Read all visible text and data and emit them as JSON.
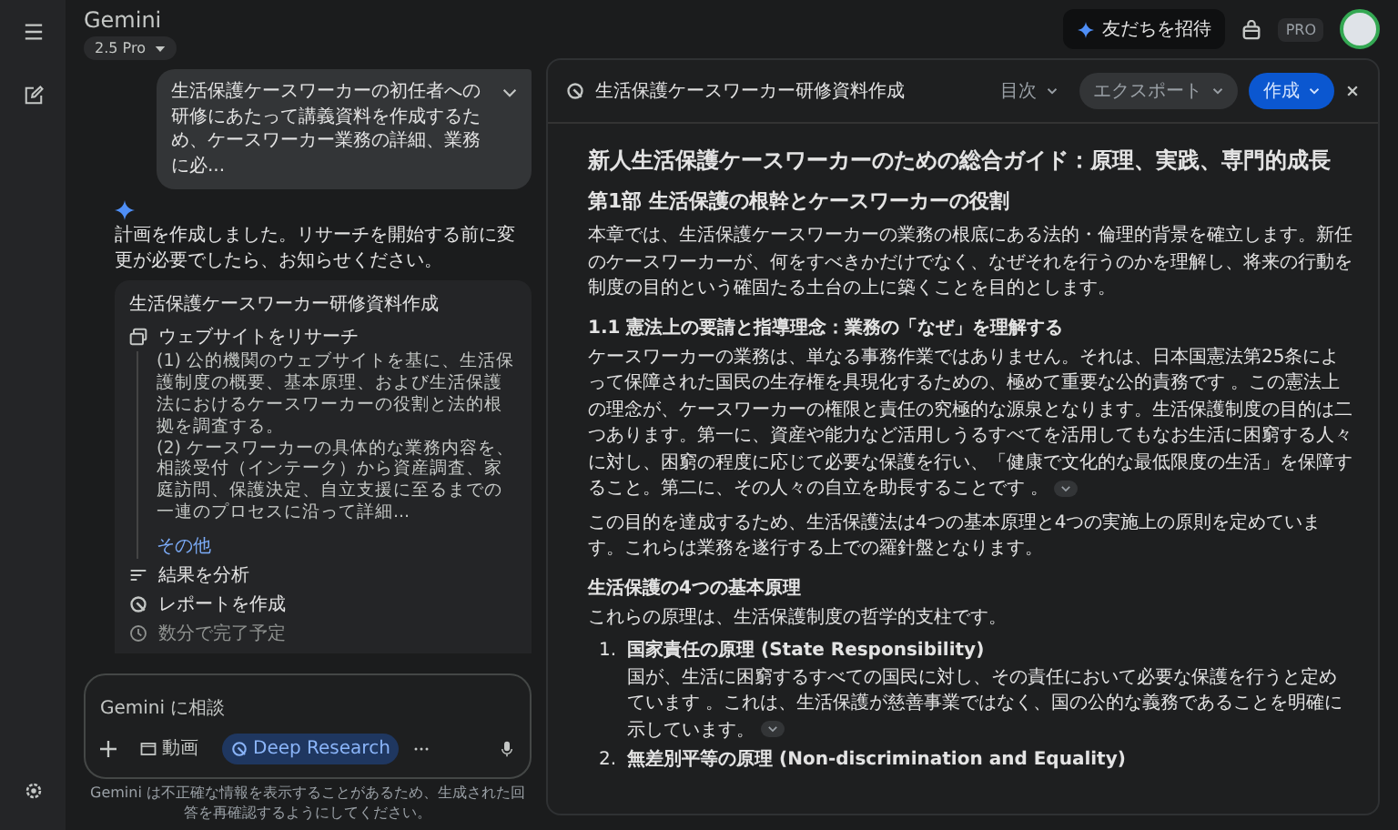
{
  "app": {
    "title": "Gemini",
    "model": "2.5 Pro"
  },
  "topbar": {
    "invite": "友だちを招待",
    "plan": "PRO"
  },
  "chat": {
    "user_message": "生活保護ケースワーカーの初任者への研修にあたって講義資料を作成するため、ケースワーカー業務の詳細、業務に必...",
    "assistant_message": "計画を作成しました。リサーチを開始する前に変更が必要でしたら、お知らせください。",
    "plan": {
      "title": "生活保護ケースワーカー研修資料作成",
      "steps": [
        {
          "kind": "research",
          "label": "ウェブサイトをリサーチ",
          "details": [
            "(1) 公的機関のウェブサイトを基に、生活保護制度の概要、基本原理、および生活保護法におけるケースワーカーの役割と法的根拠を調査する。",
            "(2) ケースワーカーの具体的な業務内容を、相談受付（インテーク）から資産調査、家庭訪問、保護決定、自立支援に至るまでの一連のプロセスに沿って詳細..."
          ],
          "more": "その他"
        },
        {
          "kind": "analyze",
          "label": "結果を分析"
        },
        {
          "kind": "report",
          "label": "レポートを作成"
        }
      ],
      "eta": "数分で完了予定"
    }
  },
  "composer": {
    "placeholder": "Gemini に相談",
    "tools": [
      {
        "kind": "video",
        "label": "動画",
        "selected": false
      },
      {
        "kind": "deep",
        "label": "Deep Research",
        "selected": true
      }
    ]
  },
  "disclaimer": "Gemini は不正確な情報を表示することがあるため、生成された回答を再確認するようにしてください。",
  "document": {
    "title": "生活保護ケースワーカー研修資料作成",
    "toc": "目次",
    "export": "エクスポート",
    "create": "作成",
    "blocks": [
      {
        "kind": "h1",
        "text": "新人生活保護ケースワーカーのための総合ガイド：原理、実践、専門的成長"
      },
      {
        "kind": "h2",
        "text": "第1部 生活保護の根幹とケースワーカーの役割"
      },
      {
        "kind": "p",
        "text": "本章では、生活保護ケースワーカーの業務の根底にある法的・倫理的背景を確立します。新任のケースワーカーが、何をすべきかだけでなく、なぜそれを行うのかを理解し、将来の行動を制度の目的という確固たる土台の上に築くことを目的とします。",
        "source_chip": false
      },
      {
        "kind": "h3",
        "text": "1.1 憲法上の要請と指導理念：業務の「なぜ」を理解する"
      },
      {
        "kind": "p",
        "text": "ケースワーカーの業務は、単なる事務作業ではありません。それは、日本国憲法第25条によって保障された国民の生存権を具現化するための、極めて重要な公的責務です 。この憲法上の理念が、ケースワーカーの権限と責任の究極的な源泉となります。生活保護制度の目的は二つあります。第一に、資産や能力など活用しうるすべてを活用してもなお生活に困窮する人々に対し、困窮の程度に応じて必要な保護を行い、「健康で文化的な最低限度の生活」を保障すること。第二に、その人々の自立を助長することです 。",
        "source_chip": true
      },
      {
        "kind": "p",
        "text": "この目的を達成するため、生活保護法は4つの基本原理と4つの実施上の原則を定めています。これらは業務を遂行する上での羅針盤となります。",
        "source_chip": false
      },
      {
        "kind": "h3",
        "text": "生活保護の4つの基本原理"
      },
      {
        "kind": "p",
        "text": "これらの原理は、生活保護制度の哲学的支柱です。",
        "source_chip": false
      },
      {
        "kind": "ol",
        "items": [
          {
            "number": "1.",
            "title": "国家責任の原理 (State Responsibility)",
            "text": "国が、生活に困窮するすべての国民に対し、その責任において必要な保護を行うと定めています 。これは、生活保護が慈善事業ではなく、国の公的な義務であることを明確に示しています。",
            "source_chip": true
          },
          {
            "number": "2.",
            "title": "無差別平等の原理 (Non-discrimination and Equality)"
          }
        ]
      }
    ]
  }
}
